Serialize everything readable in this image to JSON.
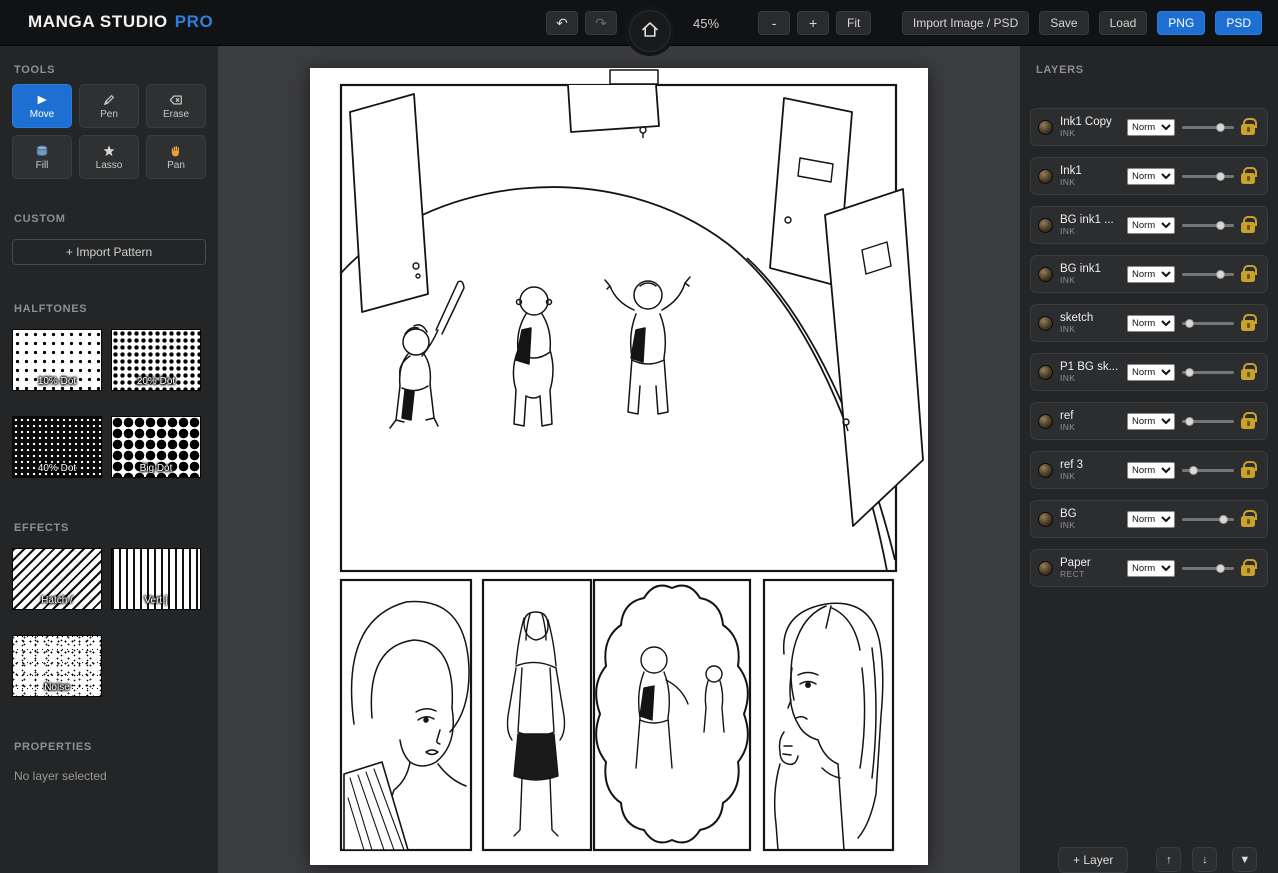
{
  "app": {
    "title": "MANGA STUDIO",
    "title_suffix": "PRO"
  },
  "topbar": {
    "undo_icon": "↶",
    "redo_icon": "↷",
    "zoom_level": "45%",
    "zoom_out": "-",
    "zoom_in": "+",
    "fit": "Fit",
    "import_psd": "Import Image / PSD",
    "save": "Save",
    "load": "Load",
    "png": "PNG",
    "psd": "PSD"
  },
  "tools": {
    "header": "TOOLS",
    "items": [
      {
        "label": "Move",
        "icon": "move-arrow-icon",
        "active": true
      },
      {
        "label": "Pen",
        "icon": "pen-icon",
        "active": false
      },
      {
        "label": "Erase",
        "icon": "eraser-icon",
        "active": false
      },
      {
        "label": "Fill",
        "icon": "fill-bucket-icon",
        "active": false
      },
      {
        "label": "Lasso",
        "icon": "lasso-star-icon",
        "active": false
      },
      {
        "label": "Pan",
        "icon": "hand-icon",
        "active": false
      }
    ]
  },
  "custom": {
    "header": "CUSTOM",
    "import_pattern": "+ Import Pattern"
  },
  "halftones": {
    "header": "HALFTONES",
    "items": [
      "10% Dot",
      "20% Dot",
      "40% Dot",
      "Big Dot"
    ]
  },
  "effects": {
    "header": "EFFECTS",
    "items": [
      "Hatch /",
      "Vert |",
      "Noise"
    ]
  },
  "properties": {
    "header": "PROPERTIES",
    "status": "No layer selected"
  },
  "layers_panel": {
    "header": "LAYERS",
    "add_layer": "+ Layer",
    "move_up": "↑",
    "move_down": "↓",
    "collapse": "▼",
    "layers": [
      {
        "name": "Ink1 Copy",
        "type": "INK",
        "blend": "Norm",
        "opacity": 0.8,
        "locked": true,
        "visible": true
      },
      {
        "name": "Ink1",
        "type": "INK",
        "blend": "Norm",
        "opacity": 0.8,
        "locked": true,
        "visible": true
      },
      {
        "name": "BG ink1 ...",
        "type": "INK",
        "blend": "Norm",
        "opacity": 0.8,
        "locked": true,
        "visible": true
      },
      {
        "name": "BG ink1",
        "type": "INK",
        "blend": "Norm",
        "opacity": 0.8,
        "locked": true,
        "visible": true
      },
      {
        "name": "sketch",
        "type": "INK",
        "blend": "Norm",
        "opacity": 0.08,
        "locked": true,
        "visible": true
      },
      {
        "name": "P1 BG sk...",
        "type": "INK",
        "blend": "Norm",
        "opacity": 0.08,
        "locked": true,
        "visible": true
      },
      {
        "name": "ref",
        "type": "INK",
        "blend": "Norm",
        "opacity": 0.08,
        "locked": true,
        "visible": true
      },
      {
        "name": "ref 3",
        "type": "INK",
        "blend": "Norm",
        "opacity": 0.16,
        "locked": true,
        "visible": true
      },
      {
        "name": "BG",
        "type": "INK",
        "blend": "Norm",
        "opacity": 0.85,
        "locked": true,
        "visible": true
      },
      {
        "name": "Paper",
        "type": "RECT",
        "blend": "Norm",
        "opacity": 0.8,
        "locked": true,
        "visible": true
      }
    ]
  },
  "colors": {
    "accent_blue": "#1e6fd2",
    "lock_gold": "#c9a22e",
    "topbar_bg": "#111214",
    "panel_bg": "#242526",
    "canvas_bg": "#3b3c3e"
  }
}
